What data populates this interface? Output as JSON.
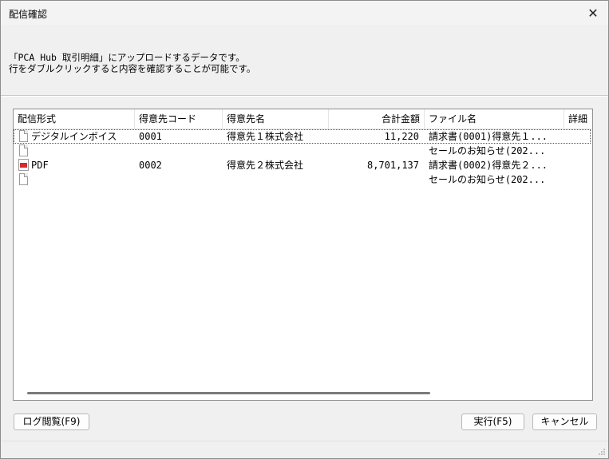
{
  "window": {
    "title": "配信確認",
    "close_glyph": "✕"
  },
  "message": {
    "line1": "「PCA Hub 取引明細」にアップロードするデータです。",
    "line2": "行をダブルクリックすると内容を確認することが可能です。"
  },
  "grid": {
    "columns": [
      "配信形式",
      "得意先コード",
      "得意先名",
      "合計金額",
      "ファイル名",
      "詳細"
    ],
    "rows": [
      {
        "icon": "document-icon",
        "format": "デジタルインボイス",
        "code": "0001",
        "name": "得意先１株式会社",
        "amount": "11,220",
        "file": "請求書(0001)得意先１...",
        "selected": true
      },
      {
        "icon": "document-icon",
        "format": "",
        "code": "",
        "name": "",
        "amount": "",
        "file": "セールのお知らせ(202..."
      },
      {
        "icon": "pdf-icon",
        "format": "PDF",
        "code": "0002",
        "name": "得意先２株式会社",
        "amount": "8,701,137",
        "file": "請求書(0002)得意先２...",
        "selected": false
      },
      {
        "icon": "document-icon",
        "format": "",
        "code": "",
        "name": "",
        "amount": "",
        "file": "セールのお知らせ(202..."
      }
    ]
  },
  "buttons": {
    "log": "ログ閲覧(F9)",
    "run": "実行(F5)",
    "cancel": "キャンセル"
  }
}
